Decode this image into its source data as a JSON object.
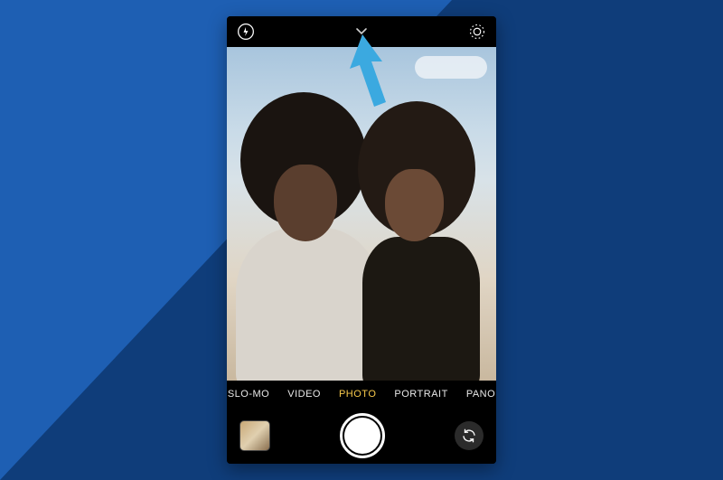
{
  "annotation": {
    "arrow_color": "#3ba9e0",
    "target": "camera-options-chevron"
  },
  "camera": {
    "topbar": {
      "flash_icon": "flash",
      "options_icon": "chevron-up",
      "live_icon": "live-photo"
    },
    "modes": {
      "items": [
        "SLO-MO",
        "VIDEO",
        "PHOTO",
        "PORTRAIT",
        "PANO"
      ],
      "active_index": 2
    },
    "bottombar": {
      "thumbnail": "last-photo",
      "shutter": "shutter",
      "flip": "switch-camera"
    }
  }
}
